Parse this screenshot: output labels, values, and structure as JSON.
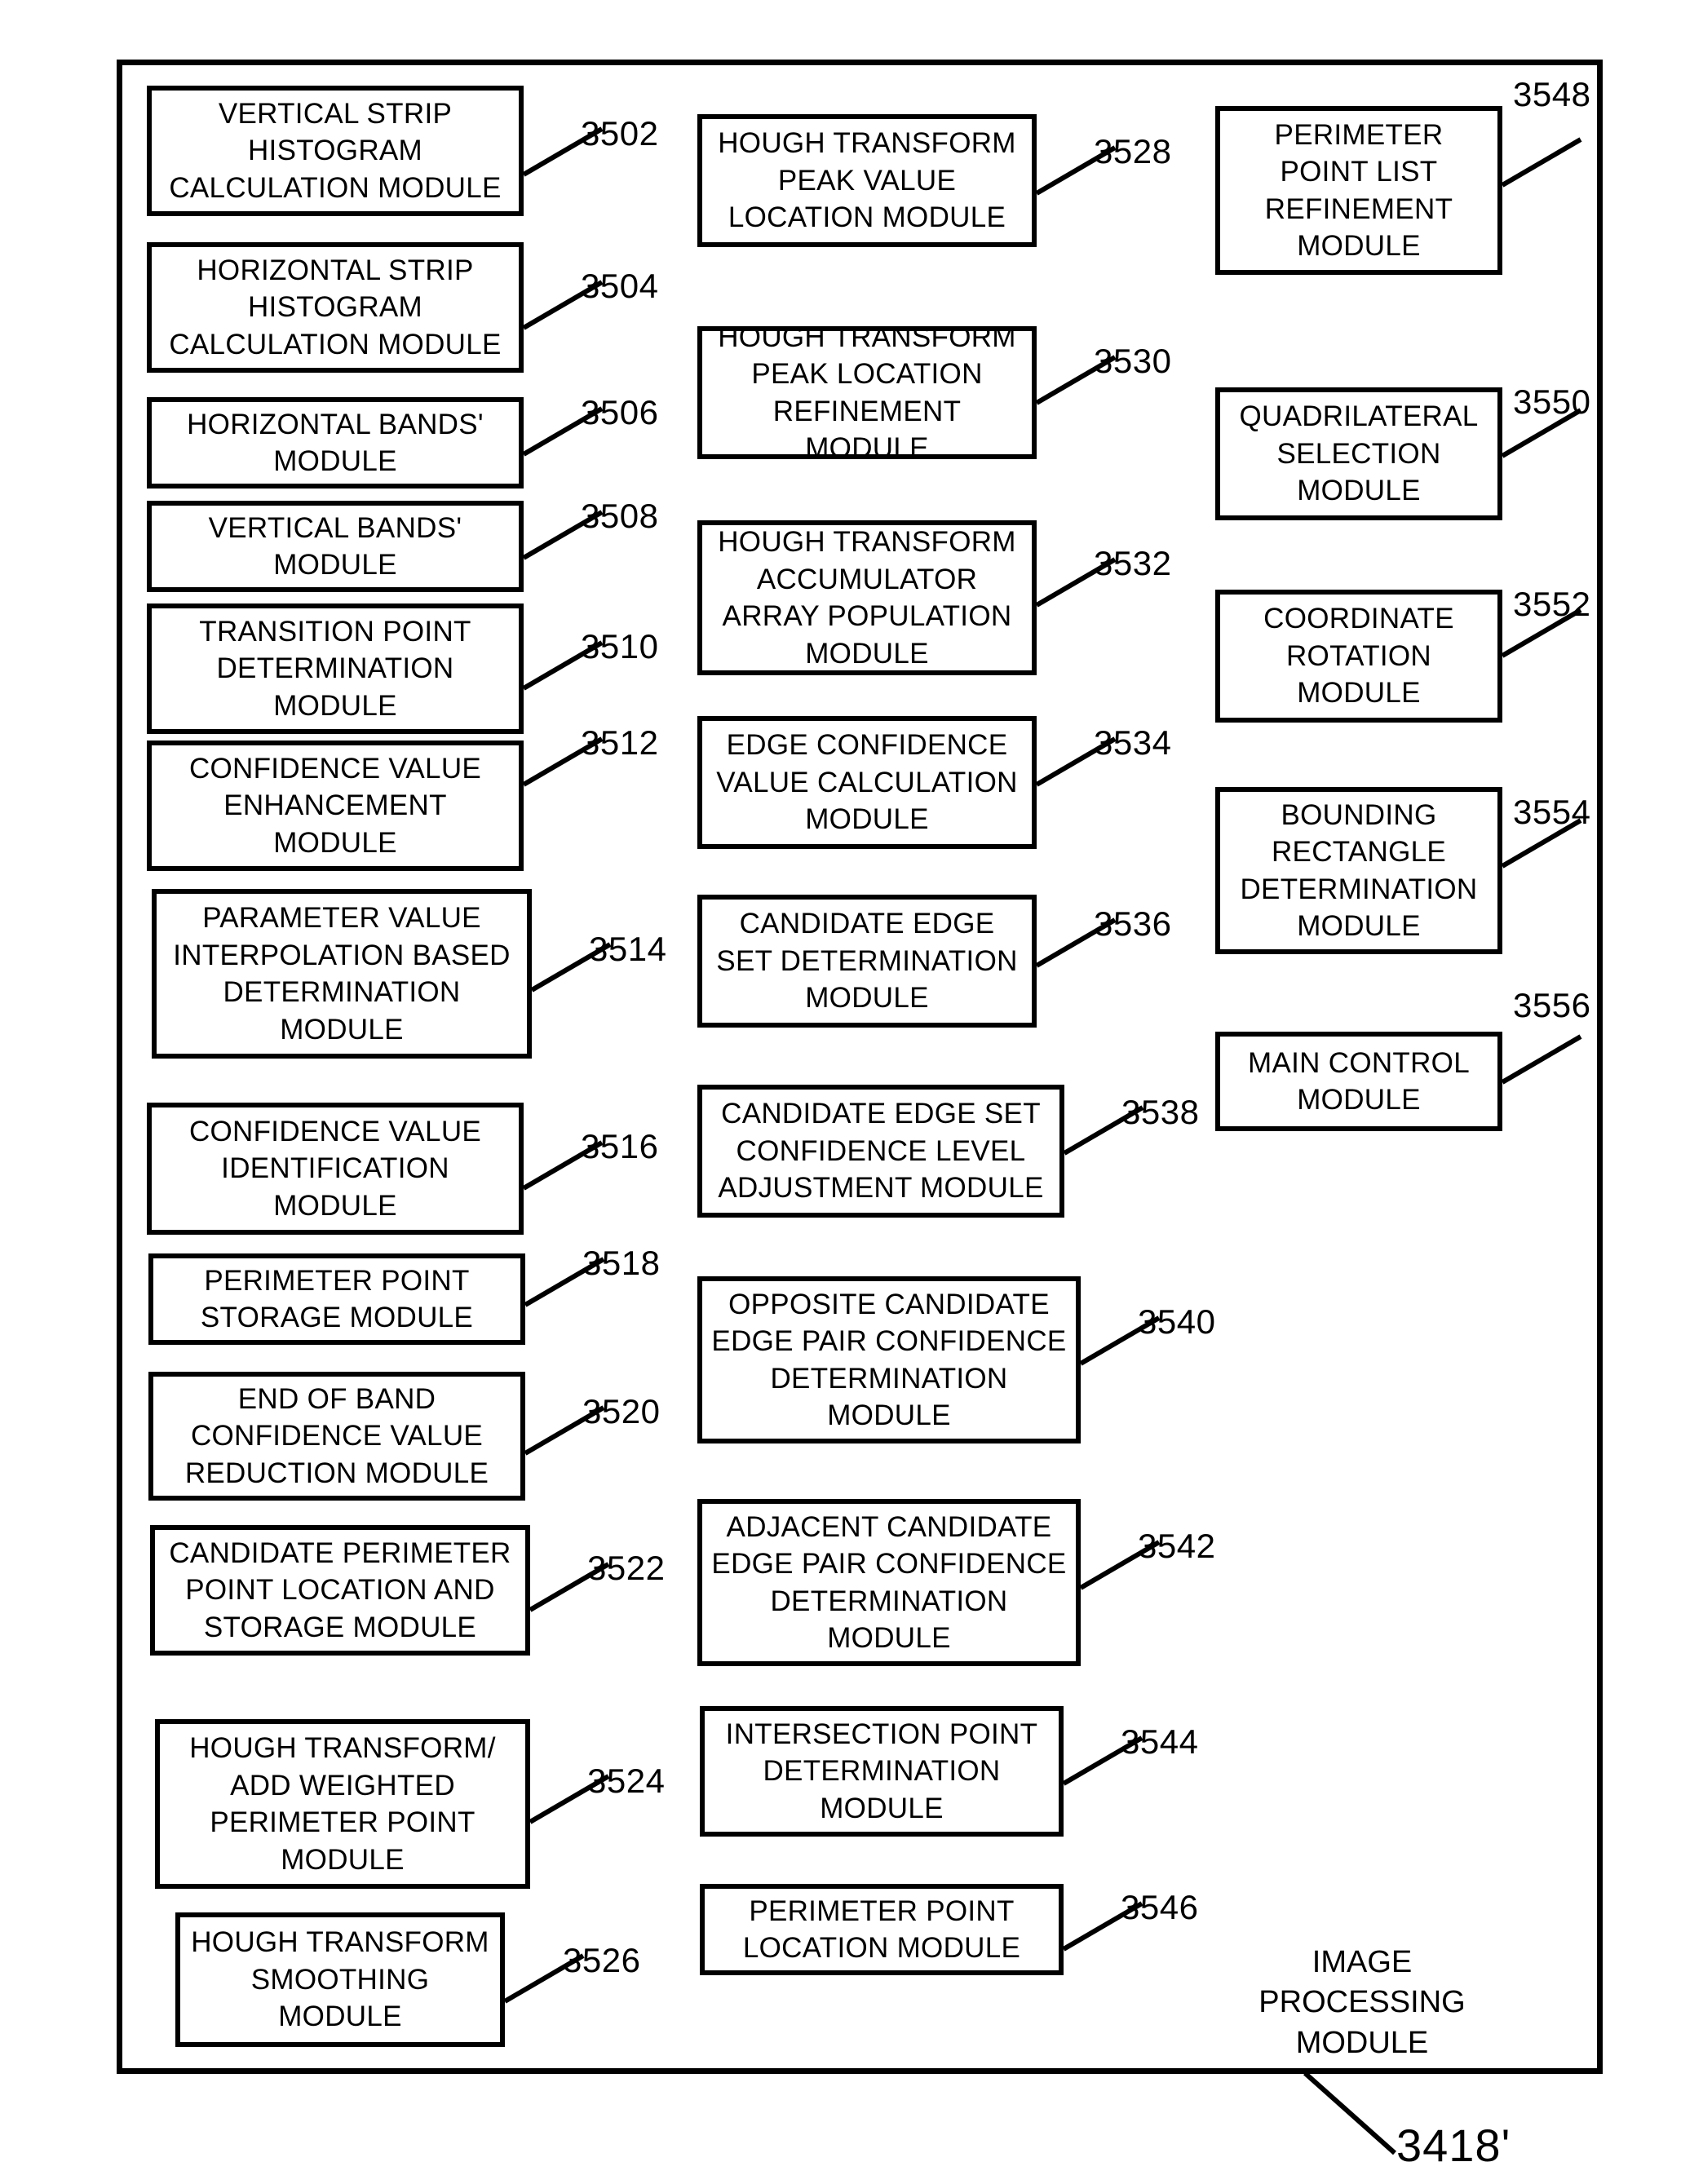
{
  "figure": {
    "container_label": "IMAGE PROCESSING\nMODULE",
    "figure_reference": "3418'"
  },
  "columns": [
    {
      "name": "left-column",
      "modules": [
        {
          "ref": "3502",
          "label": "VERTICAL STRIP\nHISTOGRAM\nCALCULATION MODULE"
        },
        {
          "ref": "3504",
          "label": "HORIZONTAL STRIP\nHISTOGRAM\nCALCULATION MODULE"
        },
        {
          "ref": "3506",
          "label": "HORIZONTAL BANDS'\nMODULE"
        },
        {
          "ref": "3508",
          "label": "VERTICAL BANDS'\nMODULE"
        },
        {
          "ref": "3510",
          "label": "TRANSITION POINT\nDETERMINATION\nMODULE"
        },
        {
          "ref": "3512",
          "label": "CONFIDENCE VALUE\nENHANCEMENT\nMODULE"
        },
        {
          "ref": "3514",
          "label": "PARAMETER VALUE\nINTERPOLATION BASED\nDETERMINATION\nMODULE"
        },
        {
          "ref": "3516",
          "label": "CONFIDENCE VALUE\nIDENTIFICATION\nMODULE"
        },
        {
          "ref": "3518",
          "label": "PERIMETER POINT\nSTORAGE MODULE"
        },
        {
          "ref": "3520",
          "label": "END OF BAND\nCONFIDENCE VALUE\nREDUCTION MODULE"
        },
        {
          "ref": "3522",
          "label": "CANDIDATE PERIMETER\nPOINT LOCATION AND\nSTORAGE MODULE"
        },
        {
          "ref": "3524",
          "label": "HOUGH TRANSFORM/\nADD WEIGHTED\nPERIMETER POINT\nMODULE"
        },
        {
          "ref": "3526",
          "label": "HOUGH TRANSFORM\nSMOOTHING\nMODULE"
        }
      ]
    },
    {
      "name": "middle-column",
      "modules": [
        {
          "ref": "3528",
          "label": "HOUGH TRANSFORM\nPEAK VALUE\nLOCATION MODULE"
        },
        {
          "ref": "3530",
          "label": "HOUGH TRANSFORM\nPEAK LOCATION\nREFINEMENT MODULE"
        },
        {
          "ref": "3532",
          "label": "HOUGH TRANSFORM\nACCUMULATOR\nARRAY POPULATION\nMODULE"
        },
        {
          "ref": "3534",
          "label": "EDGE CONFIDENCE\nVALUE CALCULATION\nMODULE"
        },
        {
          "ref": "3536",
          "label": "CANDIDATE EDGE\nSET DETERMINATION\nMODULE"
        },
        {
          "ref": "3538",
          "label": "CANDIDATE EDGE SET\nCONFIDENCE LEVEL\nADJUSTMENT MODULE"
        },
        {
          "ref": "3540",
          "label": "OPPOSITE CANDIDATE\nEDGE PAIR CONFIDENCE\nDETERMINATION\nMODULE"
        },
        {
          "ref": "3542",
          "label": "ADJACENT CANDIDATE\nEDGE PAIR CONFIDENCE\nDETERMINATION\nMODULE"
        },
        {
          "ref": "3544",
          "label": "INTERSECTION POINT\nDETERMINATION\nMODULE"
        },
        {
          "ref": "3546",
          "label": "PERIMETER POINT\nLOCATION MODULE"
        }
      ]
    },
    {
      "name": "right-column",
      "modules": [
        {
          "ref": "3548",
          "label": "PERIMETER\nPOINT LIST\nREFINEMENT\nMODULE"
        },
        {
          "ref": "3550",
          "label": "QUADRILATERAL\nSELECTION\nMODULE"
        },
        {
          "ref": "3552",
          "label": "COORDINATE\nROTATION\nMODULE"
        },
        {
          "ref": "3554",
          "label": "BOUNDING\nRECTANGLE\nDETERMINATION\nMODULE"
        },
        {
          "ref": "3556",
          "label": "MAIN CONTROL\nMODULE"
        }
      ]
    }
  ]
}
